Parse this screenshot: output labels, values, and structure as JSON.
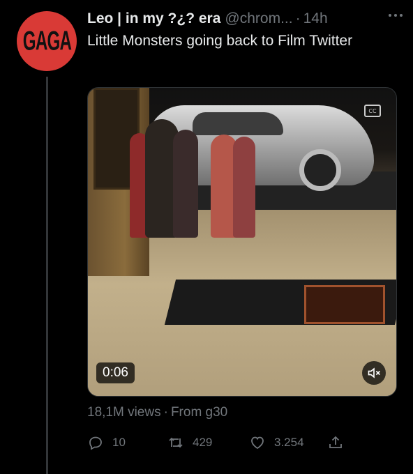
{
  "account": {
    "avatar_text": "GAGA",
    "avatar_color": "#d93a36",
    "display_name": "Leo | in my ?¿? era",
    "handle": "@chrom...",
    "separator": "·",
    "time": "14h"
  },
  "tweet": {
    "text": "Little Monsters going back to Film Twitter"
  },
  "media": {
    "type": "video",
    "cc_label": "CC",
    "duration": "0:06",
    "mute_icon": "volume-muted-icon"
  },
  "stats": {
    "views": "18,1M views",
    "separator": "·",
    "source": "From g30"
  },
  "actions": {
    "reply_count": "10",
    "retweet_count": "429",
    "like_count": "3.254"
  },
  "colors": {
    "background": "#000000",
    "text_primary": "#e7e9ea",
    "text_secondary": "#71767b"
  }
}
